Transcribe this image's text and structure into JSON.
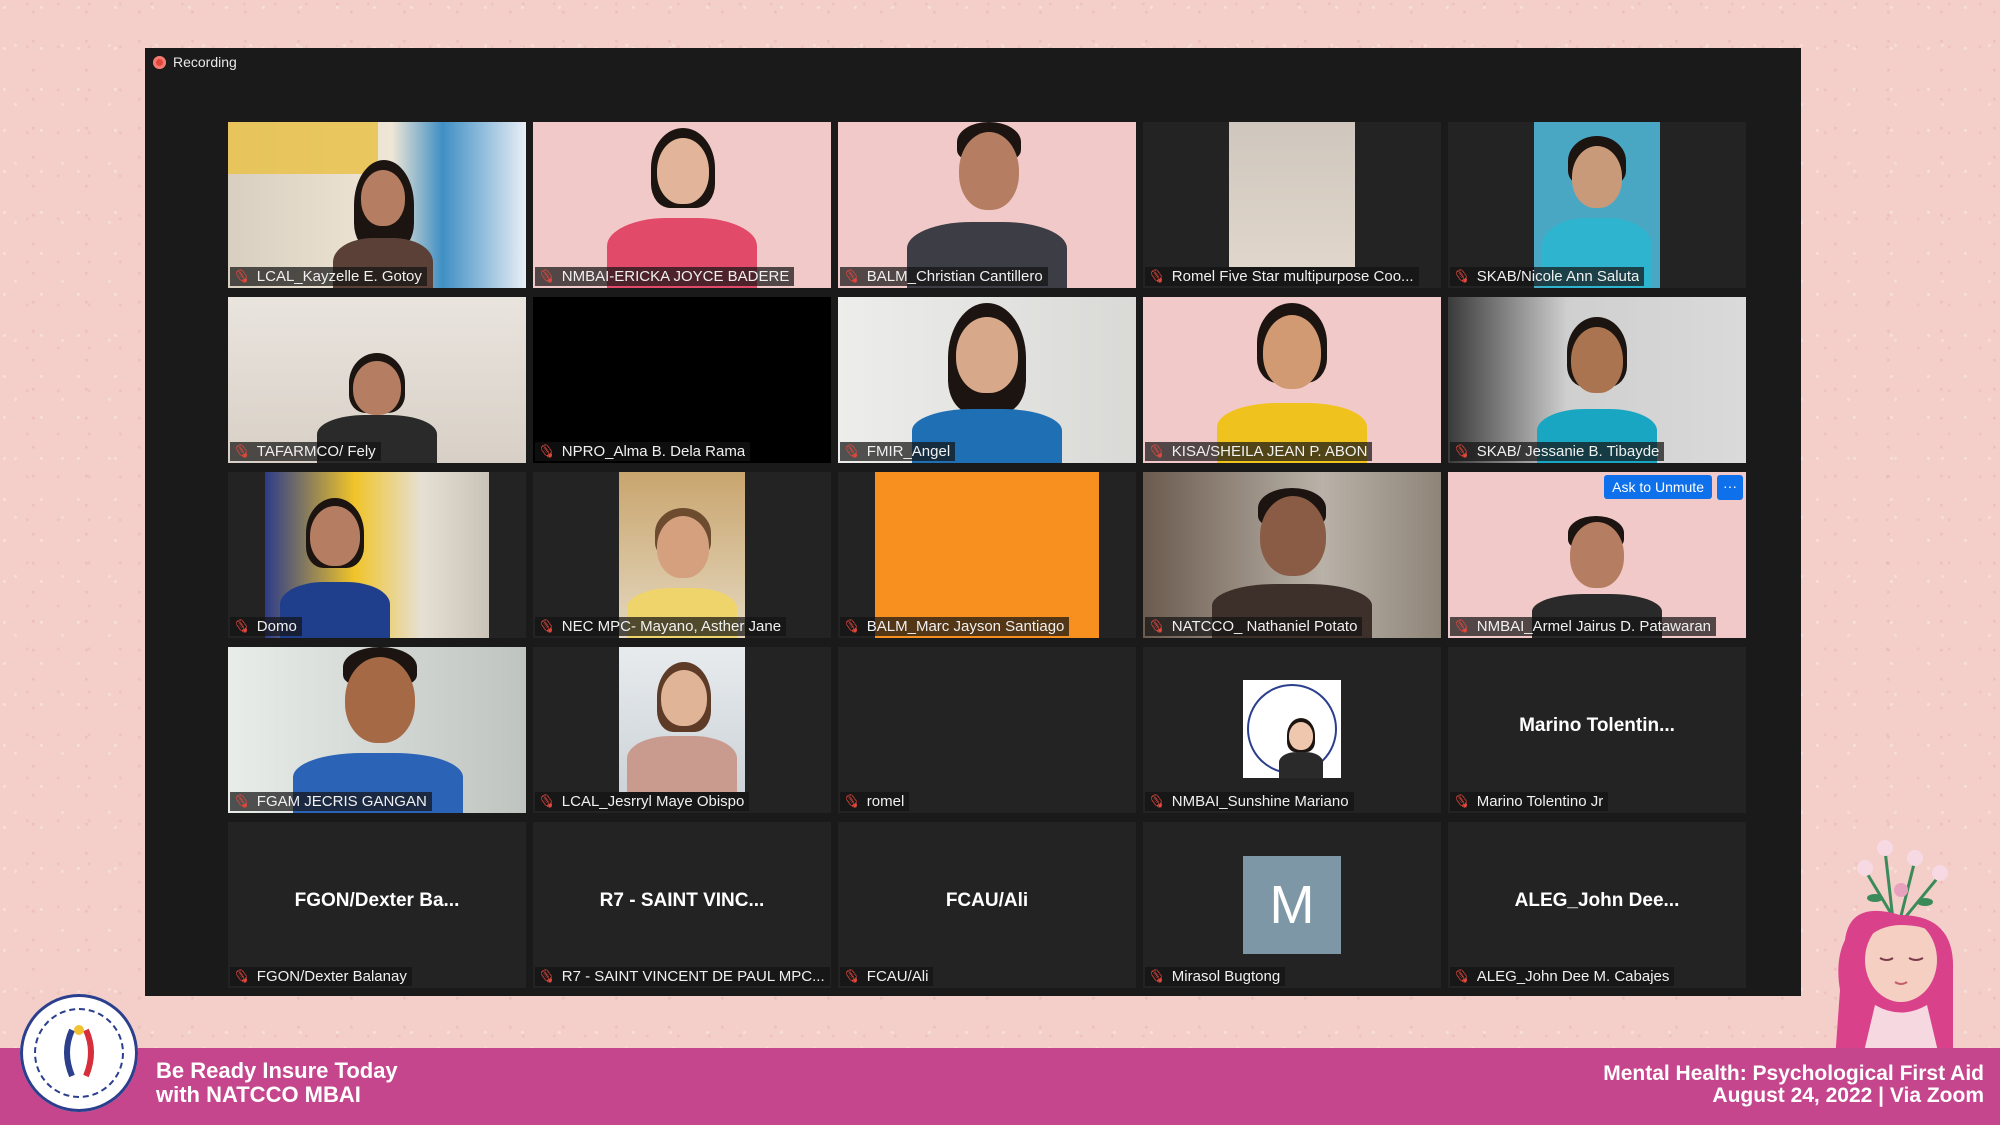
{
  "recording": {
    "label": "Recording",
    "dot_color": "#e0483e"
  },
  "tiles": [
    {
      "name": "LCAL_Kayzelle E. Gotoy"
    },
    {
      "name": "NMBAI-ERICKA JOYCE BADERE"
    },
    {
      "name": "BALM_Christian Cantillero"
    },
    {
      "name": "Romel Five Star multipurpose Coo..."
    },
    {
      "name": "SKAB/Nicole Ann Saluta"
    },
    {
      "name": "TAFARMCO/ Fely"
    },
    {
      "name": "NPRO_Alma B. Dela Rama"
    },
    {
      "name": "FMIR_Angel"
    },
    {
      "name": "KISA/SHEILA JEAN P. ABON"
    },
    {
      "name": "SKAB/ Jessanie B. Tibayde"
    },
    {
      "name": "Domo"
    },
    {
      "name": "NEC MPC- Mayano, Asther Jane"
    },
    {
      "name": "BALM_Marc Jayson Santiago"
    },
    {
      "name": "NATCCO_ Nathaniel Potato"
    },
    {
      "name": "NMBAI_Armel Jairus D. Patawaran"
    },
    {
      "name": "FGAM JECRIS GANGAN"
    },
    {
      "name": "LCAL_Jesrryl Maye Obispo"
    },
    {
      "name": "romel"
    },
    {
      "name": "NMBAI_Sunshine Mariano"
    },
    {
      "name": "Marino Tolentino Jr",
      "display": "Marino Tolentin..."
    },
    {
      "name": "FGON/Dexter Balanay",
      "display": "FGON/Dexter Ba..."
    },
    {
      "name": "R7 - SAINT VINCENT DE PAUL MPC...",
      "display": "R7 - SAINT VINC..."
    },
    {
      "name": "FCAU/Ali",
      "display": "FCAU/Ali"
    },
    {
      "name": "Mirasol Bugtong",
      "avatar_letter": "M"
    },
    {
      "name": "ALEG_John Dee M. Cabajes",
      "display": "ALEG_John Dee..."
    }
  ],
  "unmute": {
    "ask_label": "Ask to Unmute",
    "more_label": "···"
  },
  "footer": {
    "left_line1": "Be Ready Insure Today",
    "left_line2": "with NATCCO MBAI",
    "right_line1": "Mental Health: Psychological First Aid",
    "right_line2": "August 24, 2022 | Via Zoom",
    "color": "#c5468c"
  },
  "icons": {
    "mic": "mic-off-icon",
    "record": "record-icon"
  }
}
